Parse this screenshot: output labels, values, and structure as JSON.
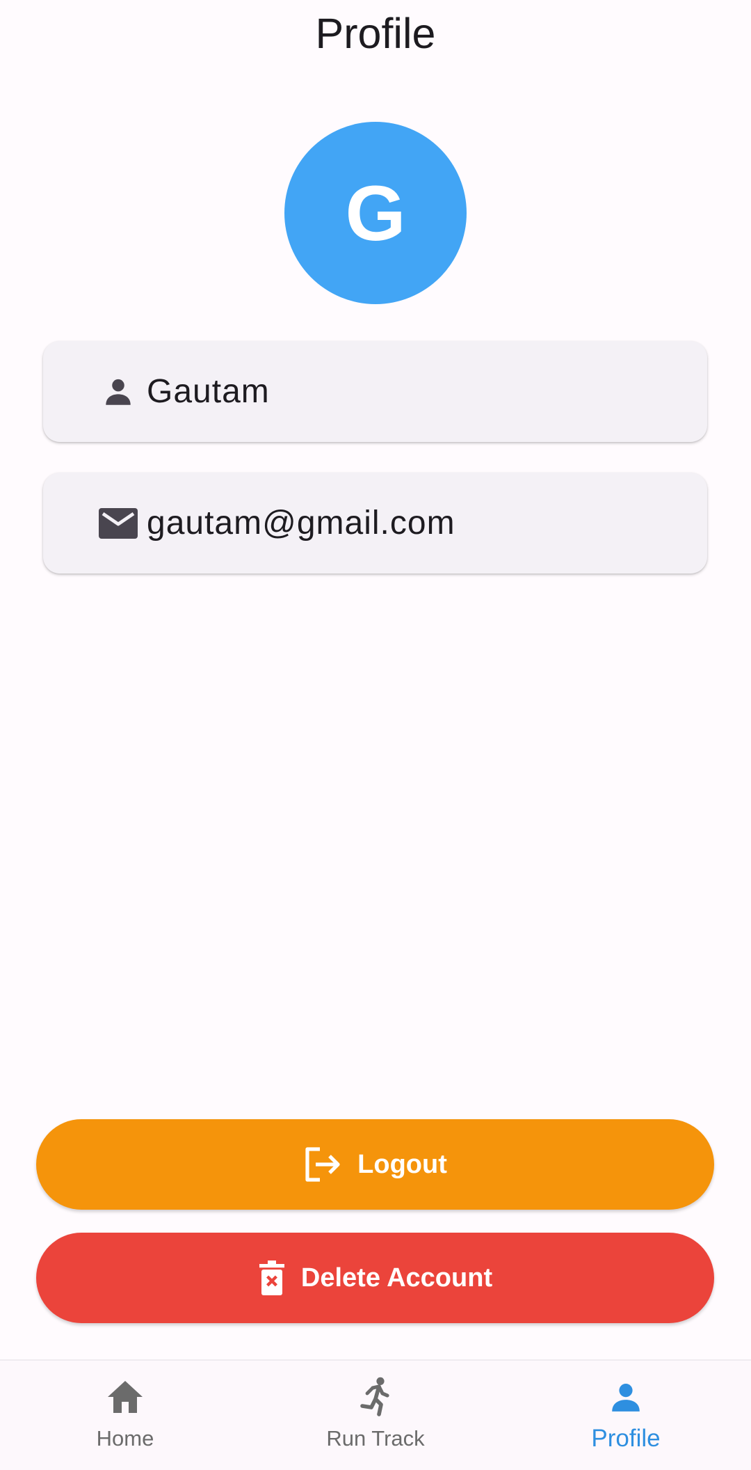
{
  "header": {
    "title": "Profile"
  },
  "avatar": {
    "initial": "G",
    "color": "#42a5f5"
  },
  "profile": {
    "name": "Gautam",
    "email": "gautam@gmail.com"
  },
  "icons": {
    "name_field": "person-icon",
    "email_field": "mail-icon",
    "logout": "logout-icon",
    "delete": "delete-forever-icon"
  },
  "actions": {
    "logout_label": "Logout",
    "logout_color": "#f5940b",
    "delete_label": "Delete Account",
    "delete_color": "#eb443b"
  },
  "bottom_nav": {
    "items": [
      {
        "label": "Home",
        "icon": "home-icon",
        "active": false
      },
      {
        "label": "Run Track",
        "icon": "running-icon",
        "active": false
      },
      {
        "label": "Profile",
        "icon": "person-icon",
        "active": true
      }
    ],
    "active_color": "#2e8fe0",
    "inactive_color": "#6b6b6b"
  }
}
